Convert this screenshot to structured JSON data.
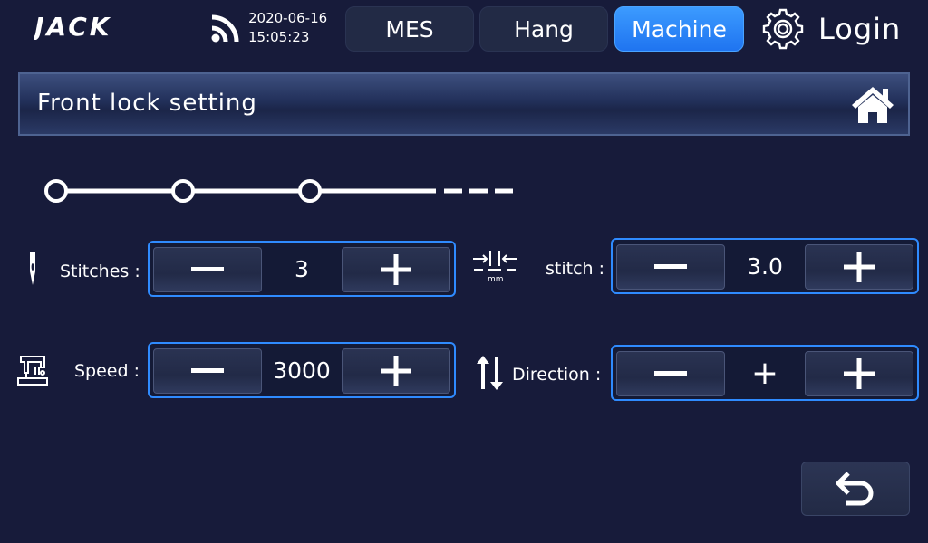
{
  "brand": {
    "logo_text": "JACK"
  },
  "status": {
    "date": "2020-06-16",
    "time": "15:05:23"
  },
  "tabs": [
    {
      "label": "MES",
      "active": false
    },
    {
      "label": "Hang",
      "active": false
    },
    {
      "label": "Machine",
      "active": true
    }
  ],
  "login": {
    "label": "Login"
  },
  "header": {
    "title": "Front lock setting"
  },
  "steps": {
    "count": 3,
    "has_more": true
  },
  "params": {
    "stitches": {
      "label": "Stitches :",
      "value": "3"
    },
    "stitch": {
      "label": "stitch :",
      "value": "3.0",
      "unit": "mm"
    },
    "speed": {
      "label": "Speed :",
      "value": "3000"
    },
    "direction": {
      "label": "Direction :",
      "value": "+"
    }
  },
  "colors": {
    "background": "#171b3a",
    "accent": "#2f8bff",
    "active_tab": "#1f74f0"
  },
  "icons": [
    "wifi-icon",
    "gear-icon",
    "home-icon",
    "needle-icon",
    "stitch-length-icon",
    "sewing-machine-icon",
    "direction-arrows-icon",
    "back-arrow-icon",
    "minus-icon",
    "plus-icon"
  ]
}
